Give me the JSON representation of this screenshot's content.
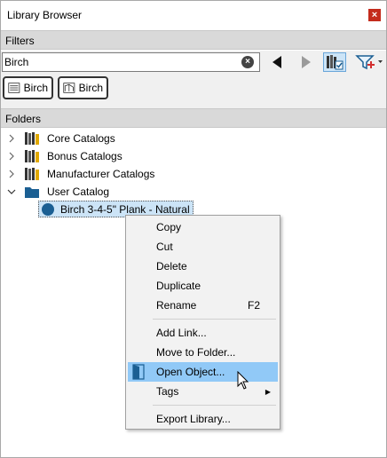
{
  "window": {
    "title": "Library Browser",
    "close_label": "×"
  },
  "filters": {
    "header": "Filters",
    "search_value": "Birch",
    "search_placeholder": "",
    "chips": [
      {
        "label": "Birch",
        "icon": "text-filter-icon"
      },
      {
        "label": "Birch",
        "icon": "object-filter-icon"
      }
    ]
  },
  "folders": {
    "header": "Folders",
    "tree": [
      {
        "label": "Core Catalogs",
        "icon": "books-icon",
        "expanded": false
      },
      {
        "label": "Bonus Catalogs",
        "icon": "books-icon",
        "expanded": false
      },
      {
        "label": "Manufacturer Catalogs",
        "icon": "books-icon",
        "expanded": false
      },
      {
        "label": "User Catalog",
        "icon": "folder-icon",
        "expanded": true
      }
    ],
    "child": {
      "label": "Birch 3-4-5\" Plank - Natural",
      "icon": "material-sphere-icon"
    }
  },
  "context_menu": {
    "items": [
      {
        "label": "Copy"
      },
      {
        "label": "Cut"
      },
      {
        "label": "Delete"
      },
      {
        "label": "Duplicate"
      },
      {
        "label": "Rename",
        "shortcut": "F2"
      },
      {
        "label": "Add Link..."
      },
      {
        "label": "Move to Folder..."
      },
      {
        "label": "Open Object...",
        "highlighted": true
      },
      {
        "label": "Tags",
        "submenu": true
      },
      {
        "label": "Export Library..."
      }
    ]
  },
  "colors": {
    "accent": "#91c9f7",
    "folder": "#1b5f93",
    "section_header": "#d9d9d9"
  }
}
